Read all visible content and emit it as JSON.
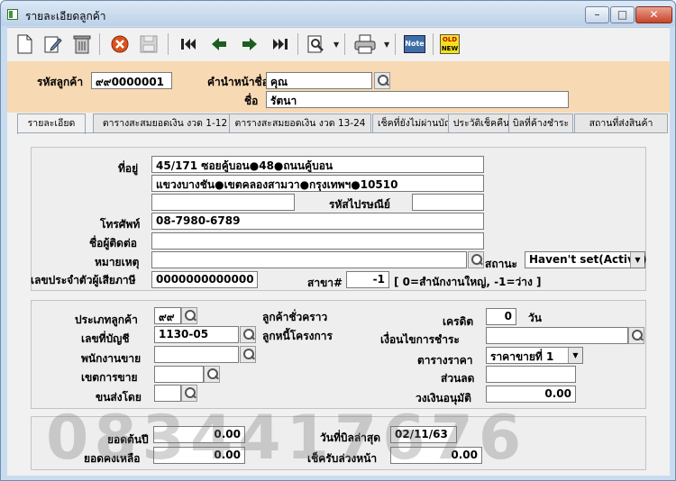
{
  "window": {
    "title": "รายละเอียดลูกค้า",
    "min_label": "–",
    "max_label": "□",
    "close_label": "✕"
  },
  "toolbar": {
    "icons": [
      "new-document-icon",
      "edit-icon",
      "trash-icon",
      "cancel-icon",
      "save-icon",
      "first-record-icon",
      "previous-record-icon",
      "next-record-icon",
      "last-record-icon",
      "search-icon",
      "print-icon",
      "note-icon",
      "old-new-icon"
    ],
    "note_label": "Note",
    "old_label": "OLD",
    "new_label": "NEW"
  },
  "header": {
    "customer_code_label": "รหัสลูกค้า",
    "customer_code": "๙๙0000001",
    "prefix_label": "คำนำหน้าชื่อ",
    "prefix": "คุณ",
    "name_label": "ชื่อ",
    "name": "รัตนา"
  },
  "tabs": [
    "รายละเอียด",
    "ตารางสะสมยอดเงิน งวด 1-12",
    "ตารางสะสมยอดเงิน งวด 13-24",
    "เช็คที่ยังไม่ผ่านบัญชี",
    "ประวัติเช็คคืน",
    "บิลที่ค้างชำระ",
    "สถานที่ส่งสินค้า"
  ],
  "detail": {
    "address_label": "ที่อยู่",
    "address1": "45/171 ซอยคู้บอน●48●ถนนคู้บอน",
    "address2": "แขวงบางชัน●เขตคลองสามวา●กรุงเทพฯ●10510",
    "address3": "",
    "postcode_label": "รหัสไปรษณีย์",
    "postcode": "",
    "phone_label": "โทรศัพท์",
    "phone": "08-7980-6789",
    "contact_label": "ชื่อผู้ติดต่อ",
    "contact": "",
    "note_label": "หมายเหตุ",
    "note": "",
    "status_label": "สถานะ",
    "status": "Haven't set(Active)",
    "tax_id_label": "เลขประจำตัวผู้เสียภาษี",
    "tax_id": "0000000000000",
    "branch_label": "สาขา#",
    "branch": "-1",
    "branch_hint": "[ 0=สำนักงานใหญ่, -1=ว่าง ]"
  },
  "sales": {
    "customer_type_label": "ประเภทลูกค้า",
    "customer_type": "๙๙",
    "temp_customer_label": "ลูกค้าชั่วคราว",
    "account_label": "เลขที่บัญชี",
    "account": "1130-05",
    "project_debtor_label": "ลูกหนี้โครงการ",
    "salesperson_label": "พนักงานขาย",
    "salesperson": "",
    "sales_zone_label": "เขตการขาย",
    "sales_zone": "",
    "ship_by_label": "ขนส่งโดย",
    "ship_by": "",
    "credit_label": "เครดิต",
    "credit": "0",
    "credit_unit": "วัน",
    "payment_terms_label": "เงื่อนไขการชำระ",
    "payment_terms": "",
    "price_table_label": "ตารางราคา",
    "price_table": "ราคาขายที่ 1",
    "discount_label": "ส่วนลด",
    "discount": "",
    "credit_limit_label": "วงเงินอนุมัติ",
    "credit_limit": "0.00"
  },
  "balance": {
    "opening_label": "ยอดต้นปี",
    "opening": "0.00",
    "last_bill_label": "วันที่บิลล่าสุด",
    "last_bill": "02/11/63",
    "remaining_label": "ยอดคงเหลือ",
    "remaining": "0.00",
    "advance_check_label": "เช็ครับล่วงหน้า",
    "advance_check": "0.00"
  },
  "watermark": "0834417676"
}
